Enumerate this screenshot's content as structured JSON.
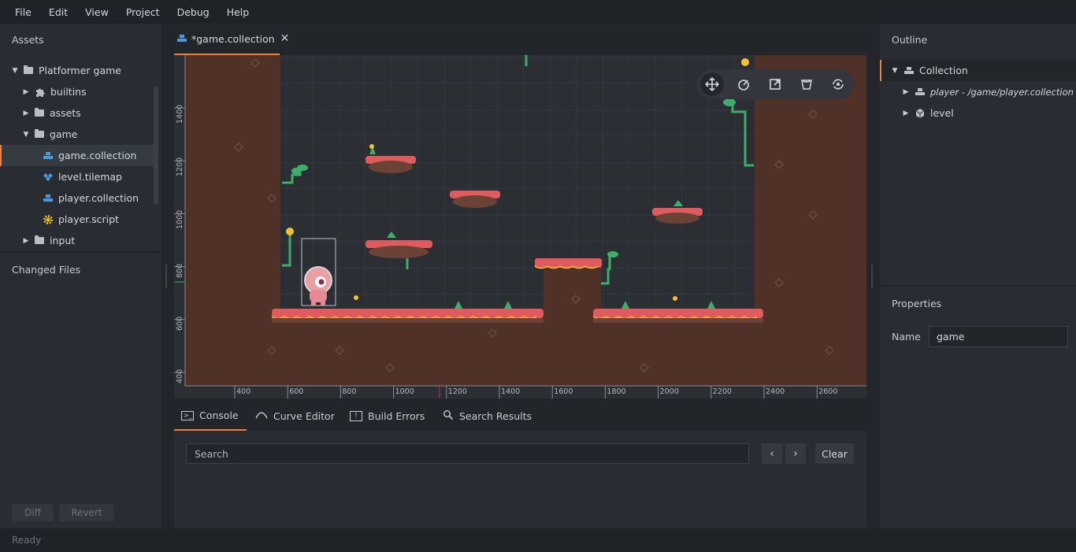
{
  "menu": [
    "File",
    "Edit",
    "View",
    "Project",
    "Debug",
    "Help"
  ],
  "assets": {
    "title": "Assets",
    "items": [
      {
        "label": "Platformer game",
        "type": "folder",
        "expanded": true
      },
      {
        "label": "builtins",
        "type": "builtins",
        "expanded": false
      },
      {
        "label": "assets",
        "type": "folder",
        "expanded": false
      },
      {
        "label": "game",
        "type": "folder",
        "expanded": true
      },
      {
        "label": "game.collection",
        "type": "collection"
      },
      {
        "label": "level.tilemap",
        "type": "tilemap"
      },
      {
        "label": "player.collection",
        "type": "collection"
      },
      {
        "label": "player.script",
        "type": "script"
      },
      {
        "label": "input",
        "type": "folder",
        "expanded": false
      }
    ]
  },
  "changed_files": {
    "title": "Changed Files",
    "diff_label": "Diff",
    "revert_label": "Revert"
  },
  "editor": {
    "tab_label": "*game.collection",
    "x_ruler": [
      "400",
      "600",
      "800",
      "1000",
      "1200",
      "1400",
      "1600",
      "1800",
      "2000",
      "2200",
      "2400",
      "2600"
    ],
    "y_ruler": [
      "1400",
      "1200",
      "1000",
      "800",
      "600",
      "400"
    ]
  },
  "toolbar_icons": [
    "move-icon",
    "rotate-icon",
    "scale-icon",
    "perspective-icon",
    "camera-reset-icon"
  ],
  "bottom": {
    "tabs": [
      "Console",
      "Curve Editor",
      "Build Errors",
      "Search Results"
    ],
    "search_placeholder": "Search",
    "clear_label": "Clear"
  },
  "outline": {
    "title": "Outline",
    "items": [
      {
        "label": "Collection",
        "expanded": true
      },
      {
        "label": "player - /game/player.collection",
        "expanded": false
      },
      {
        "label": "level",
        "expanded": false
      }
    ]
  },
  "properties": {
    "title": "Properties",
    "name_label": "Name",
    "name_value": "game"
  },
  "status": "Ready",
  "colors": {
    "accent": "#f0803c",
    "dirt": "#4f3128",
    "platform_top": "#e05a5e",
    "plant": "#3fae6b"
  }
}
